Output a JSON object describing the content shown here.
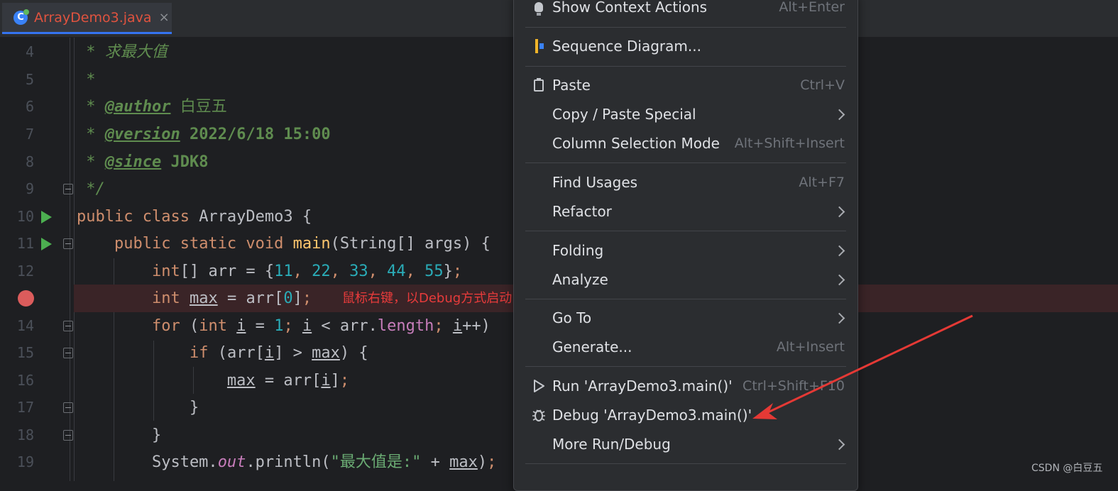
{
  "tab": {
    "title": "ArrayDemo3.java",
    "close": "×",
    "icon": "C"
  },
  "code_lines": [
    {
      "num": "4"
    },
    {
      "num": "5"
    },
    {
      "num": "6"
    },
    {
      "num": "7"
    },
    {
      "num": "8"
    },
    {
      "num": "9"
    },
    {
      "num": "10"
    },
    {
      "num": "11"
    },
    {
      "num": "12"
    },
    {
      "num": "13"
    },
    {
      "num": "14"
    },
    {
      "num": "15"
    },
    {
      "num": "16"
    },
    {
      "num": "17"
    },
    {
      "num": "18"
    },
    {
      "num": "19"
    }
  ],
  "code": {
    "l4_text": "求最大值",
    "l6_tag": "@author",
    "l6_val": "白豆五",
    "l7_tag": "@version",
    "l7_val": "2022/6/18 15:00",
    "l8_tag": "@since",
    "l8_val": "JDK8",
    "l10_cls": "ArrayDemo3",
    "l11_method": "main",
    "l12_values": [
      "11",
      "22",
      "33",
      "44",
      "55"
    ],
    "l19_str": "\"最大值是:\""
  },
  "annotation": "鼠标右键，以Debug方式启动",
  "context_menu": {
    "items": [
      {
        "label": "Show Context Actions",
        "shortcut": "Alt+Enter",
        "icon": "lightbulb-icon"
      },
      {
        "label": "Sequence Diagram...",
        "icon": "sequence-diagram-icon"
      },
      {
        "label": "Paste",
        "shortcut": "Ctrl+V",
        "icon": "clipboard-icon"
      },
      {
        "label": "Copy / Paste Special",
        "submenu": true
      },
      {
        "label": "Column Selection Mode",
        "shortcut": "Alt+Shift+Insert"
      },
      {
        "label": "Find Usages",
        "shortcut": "Alt+F7"
      },
      {
        "label": "Refactor",
        "submenu": true
      },
      {
        "label": "Folding",
        "submenu": true
      },
      {
        "label": "Analyze",
        "submenu": true
      },
      {
        "label": "Go To",
        "submenu": true
      },
      {
        "label": "Generate...",
        "shortcut": "Alt+Insert"
      },
      {
        "label": "Run 'ArrayDemo3.main()'",
        "shortcut": "Ctrl+Shift+F10",
        "icon": "run-icon"
      },
      {
        "label": "Debug 'ArrayDemo3.main()'",
        "icon": "debug-bug-icon"
      },
      {
        "label": "More Run/Debug",
        "submenu": true
      }
    ]
  },
  "colors": {
    "arrow": "#e53935",
    "breakpoint": "#db5c5c",
    "annotation": "#e83b3b"
  },
  "watermark": "CSDN @白豆五"
}
